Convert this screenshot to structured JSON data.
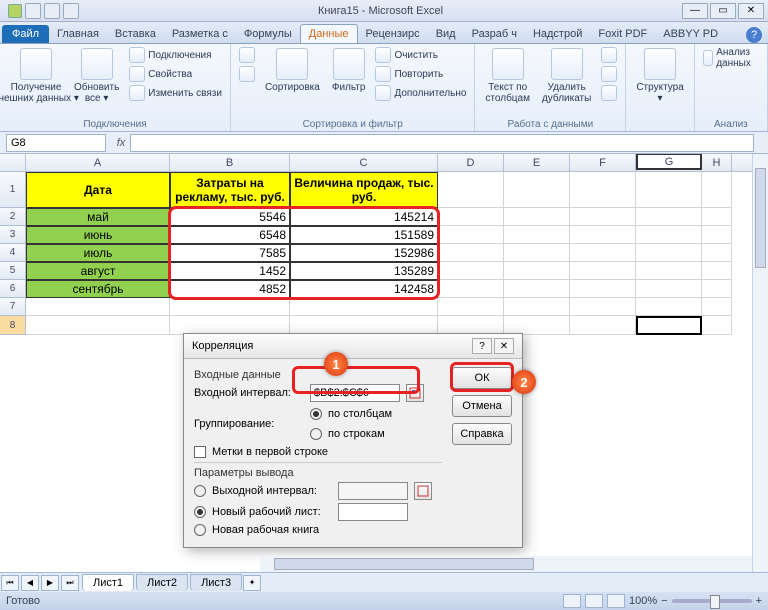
{
  "window": {
    "title": "Книга15 - Microsoft Excel"
  },
  "tabs": {
    "file": "Файл",
    "items": [
      "Главная",
      "Вставка",
      "Разметка с",
      "Формулы",
      "Данные",
      "Рецензирс",
      "Вид",
      "Разраб   ч",
      "Надстрой",
      "Foxit PDF",
      "ABBYY PD"
    ]
  },
  "ribbon": {
    "g1": {
      "label": "Подключения",
      "btn1": "Получение\nвнешних данных ▾",
      "btn2": "Обновить\nвсе ▾",
      "m1": "Подключения",
      "m2": "Свойства",
      "m3": "Изменить связи"
    },
    "g2": {
      "label": "Сортировка и фильтр",
      "sort_a": "А↓",
      "sort_z": "Я↓",
      "sort": "Сортировка",
      "filter": "Фильтр",
      "m1": "Очистить",
      "m2": "Повторить",
      "m3": "Дополнительно"
    },
    "g3": {
      "label": "Работа с данными",
      "ttc": "Текст по\nстолбцам",
      "dup": "Удалить\nдубликаты"
    },
    "g4": {
      "label": "",
      "struct": "Структура\n▾"
    },
    "g5": {
      "label": "Анализ",
      "da": "Анализ данных"
    }
  },
  "namebox": "G8",
  "columns": [
    "A",
    "B",
    "C",
    "D",
    "E",
    "F",
    "G",
    "H"
  ],
  "headers": {
    "a": "Дата",
    "b": "Затраты на рекламу, тыс. руб.",
    "c": "Величина продаж, тыс. руб."
  },
  "data": {
    "months": [
      "май",
      "июнь",
      "июль",
      "август",
      "сентябрь"
    ],
    "ad": [
      5546,
      6548,
      7585,
      1452,
      4852
    ],
    "sales": [
      145214,
      151589,
      152986,
      135289,
      142458
    ]
  },
  "dialog": {
    "title": "Корреляция",
    "sec1": "Входные данные",
    "lbl_range": "Входной интервал:",
    "range": "$B$2:$C$6",
    "lbl_group": "Группирование:",
    "opt_cols": "по столбцам",
    "opt_rows": "по строкам",
    "chk_labels": "Метки в первой строке",
    "sec2": "Параметры вывода",
    "opt_out_range": "Выходной интервал:",
    "opt_out_sheet": "Новый рабочий лист:",
    "opt_out_book": "Новая рабочая книга",
    "ok": "ОК",
    "cancel": "Отмена",
    "help": "Справка"
  },
  "sheets": [
    "Лист1",
    "Лист2",
    "Лист3"
  ],
  "status": {
    "ready": "Готово",
    "zoom": "100%"
  }
}
